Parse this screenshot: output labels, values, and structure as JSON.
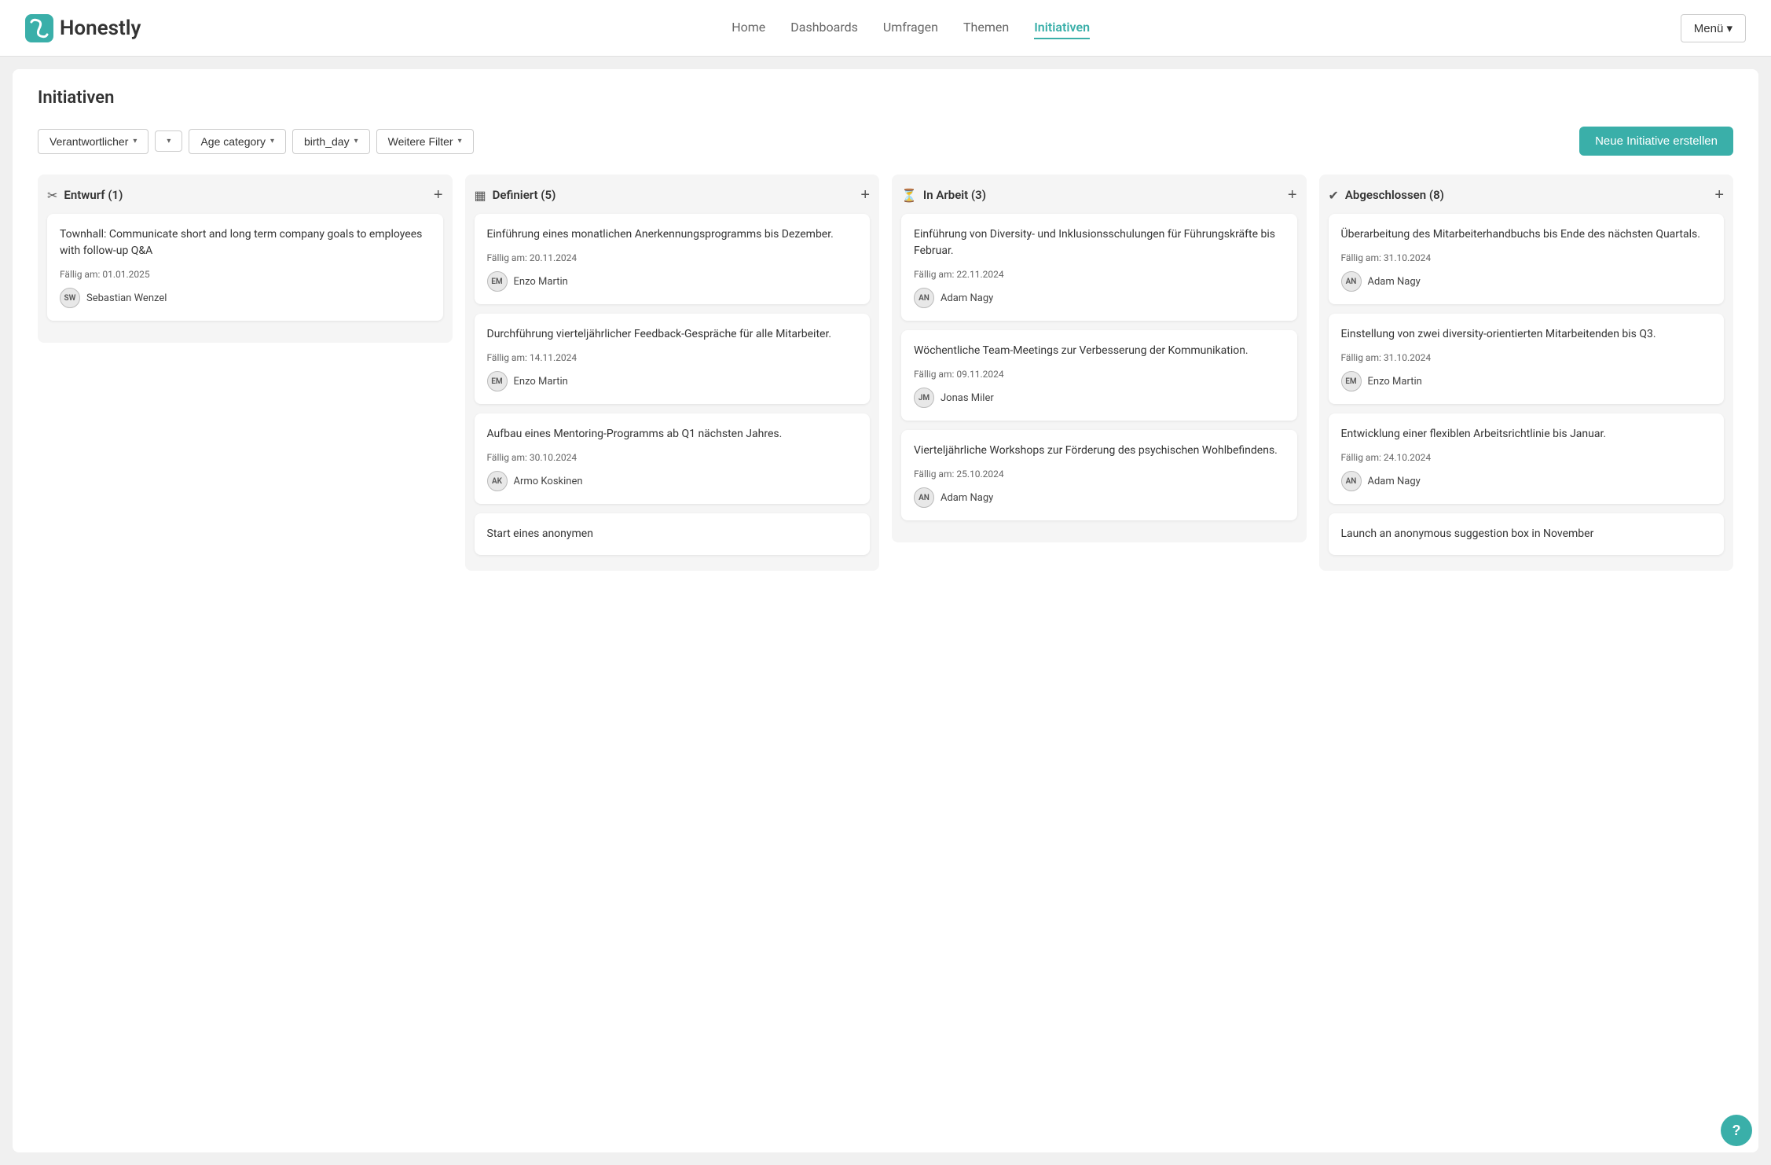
{
  "app": {
    "name": "Honestly",
    "logo_alt": "Honestly logo"
  },
  "nav": {
    "items": [
      {
        "label": "Home",
        "active": false
      },
      {
        "label": "Dashboards",
        "active": false
      },
      {
        "label": "Umfragen",
        "active": false
      },
      {
        "label": "Themen",
        "active": false
      },
      {
        "label": "Initiativen",
        "active": true
      }
    ],
    "menu_label": "Menü ▾"
  },
  "page": {
    "title": "Initiativen",
    "new_initiative_label": "Neue Initiative erstellen"
  },
  "filters": {
    "verantwortlicher": "Verantwortlicher",
    "extra": "▾",
    "age_category": "Age category",
    "birth_day": "birth_day",
    "weitere_filter": "Weitere Filter"
  },
  "columns": [
    {
      "id": "entwurf",
      "icon": "✂",
      "title": "Entwurf (1)",
      "cards": [
        {
          "title": "Townhall: Communicate short and long term company goals to employees with follow-up Q&A",
          "due": "Fällig am: 01.01.2025",
          "assignee_initials": "SW",
          "assignee_name": "Sebastian Wenzel"
        }
      ],
      "partial_card": null
    },
    {
      "id": "definiert",
      "icon": "▦",
      "title": "Definiert (5)",
      "cards": [
        {
          "title": "Einführung eines monatlichen Anerkennungsprogramms bis Dezember.",
          "due": "Fällig am: 20.11.2024",
          "assignee_initials": "EM",
          "assignee_name": "Enzo Martin"
        },
        {
          "title": "Durchführung vierteljährlicher Feedback-Gespräche für alle Mitarbeiter.",
          "due": "Fällig am: 14.11.2024",
          "assignee_initials": "EM",
          "assignee_name": "Enzo Martin"
        },
        {
          "title": "Aufbau eines Mentoring-Programms ab Q1 nächsten Jahres.",
          "due": "Fällig am: 30.10.2024",
          "assignee_initials": "AK",
          "assignee_name": "Armo Koskinen"
        }
      ],
      "partial_card": "Start eines anonymen"
    },
    {
      "id": "in-arbeit",
      "icon": "⏳",
      "title": "In Arbeit (3)",
      "cards": [
        {
          "title": "Einführung von Diversity- und Inklusionsschulungen für Führungskräfte bis Februar.",
          "due": "Fällig am: 22.11.2024",
          "assignee_initials": "AN",
          "assignee_name": "Adam Nagy"
        },
        {
          "title": "Wöchentliche Team-Meetings zur Verbesserung der Kommunikation.",
          "due": "Fällig am: 09.11.2024",
          "assignee_initials": "JM",
          "assignee_name": "Jonas Miler"
        },
        {
          "title": "Vierteljährliche Workshops zur Förderung des psychischen Wohlbefindens.",
          "due": "Fällig am: 25.10.2024",
          "assignee_initials": "AN",
          "assignee_name": "Adam Nagy"
        }
      ],
      "partial_card": null
    },
    {
      "id": "abgeschlossen",
      "icon": "✔",
      "title": "Abgeschlossen (8)",
      "cards": [
        {
          "title": "Überarbeitung des Mitarbeiterhandbuchs bis Ende des nächsten Quartals.",
          "due": "Fällig am: 31.10.2024",
          "assignee_initials": "AN",
          "assignee_name": "Adam Nagy"
        },
        {
          "title": "Einstellung von zwei diversity-orientierten Mitarbeitenden bis Q3.",
          "due": "Fällig am: 31.10.2024",
          "assignee_initials": "EM",
          "assignee_name": "Enzo Martin"
        },
        {
          "title": "Entwicklung einer flexiblen Arbeitsrichtlinie bis Januar.",
          "due": "Fällig am: 24.10.2024",
          "assignee_initials": "AN",
          "assignee_name": "Adam Nagy"
        }
      ],
      "partial_card": "Launch an anonymous suggestion box in November"
    }
  ],
  "help_button": "?"
}
